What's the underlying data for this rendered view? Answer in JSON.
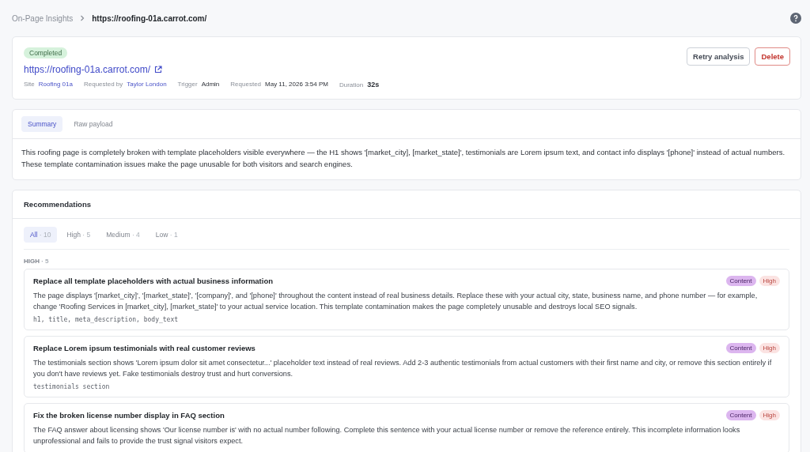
{
  "breadcrumb": {
    "parent": "On-Page Insights",
    "current": "https://roofing-01a.carrot.com/"
  },
  "header": {
    "status": "Completed",
    "url": "https://roofing-01a.carrot.com/",
    "buttons": [
      {
        "label": "Retry analysis",
        "kind": "secondary"
      },
      {
        "label": "Delete",
        "kind": "danger"
      }
    ],
    "meta": [
      {
        "label": "Site",
        "value": "Roofing 01a",
        "kind": "link"
      },
      {
        "label": "Requested by",
        "value": "Taylor London",
        "kind": "link"
      },
      {
        "label": "Trigger",
        "value": "Admin",
        "kind": "text"
      },
      {
        "label": "Requested",
        "value": "May 11, 2026 3:54 PM",
        "kind": "text"
      },
      {
        "label": "Duration",
        "value": "32s",
        "kind": "strong"
      }
    ]
  },
  "summary": {
    "tabs": [
      {
        "label": "Summary",
        "selected": true
      },
      {
        "label": "Raw payload",
        "selected": false
      }
    ],
    "text": "This roofing page is completely broken with template placeholders visible everywhere — the H1 shows '[market_city], [market_state]', testimonials are Lorem ipsum text, and contact info displays '[phone]' instead of actual numbers. These template contamination issues make the page unusable for both visitors and search engines."
  },
  "recommendations": {
    "title": "Recommendations",
    "filters": [
      {
        "label": "All",
        "count": "· 10",
        "selected": true
      },
      {
        "label": "High",
        "count": "· 5",
        "selected": false
      },
      {
        "label": "Medium",
        "count": "· 4",
        "selected": false
      },
      {
        "label": "Low",
        "count": "· 1",
        "selected": false
      }
    ],
    "group": {
      "label": "HIGH",
      "count": "· 5"
    },
    "items": [
      {
        "title": "Replace all template placeholders with actual business information",
        "tags": [
          {
            "label": "Content",
            "kind": "category"
          },
          {
            "label": "High",
            "kind": "priority"
          }
        ],
        "text": "The page displays '[market_city]', '[market_state]', '[company]', and '[phone]' throughout the content instead of real business details. Replace these with your actual city, state, business name, and phone number — for example, change 'Roofing Services in [market_city], [market_state]' to your actual service location. This template contamination makes the page completely unusable and destroys local SEO signals.",
        "fields": "h1, title, meta_description, body_text"
      },
      {
        "title": "Replace Lorem ipsum testimonials with real customer reviews",
        "tags": [
          {
            "label": "Content",
            "kind": "category"
          },
          {
            "label": "High",
            "kind": "priority"
          }
        ],
        "text": "The testimonials section shows 'Lorem ipsum dolor sit amet consectetur...' placeholder text instead of real reviews. Add 2-3 authentic testimonials from actual customers with their first name and city, or remove this section entirely if you don't have reviews yet. Fake testimonials destroy trust and hurt conversions.",
        "fields": "testimonials section"
      },
      {
        "title": "Fix the broken license number display in FAQ section",
        "tags": [
          {
            "label": "Content",
            "kind": "category"
          },
          {
            "label": "High",
            "kind": "priority"
          }
        ],
        "text": "The FAQ answer about licensing shows 'Our license number is' with no actual number following. Complete this sentence with your actual license number or remove the reference entirely. This incomplete information looks unprofessional and fails to provide the trust signal visitors expect."
      }
    ]
  }
}
